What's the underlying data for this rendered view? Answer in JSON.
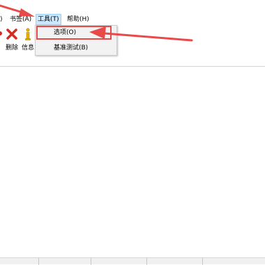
{
  "menubar": {
    "items": [
      {
        "label": ")"
      },
      {
        "label": "书签(A)"
      },
      {
        "label": "工具(T)"
      },
      {
        "label": "帮助(H)"
      }
    ]
  },
  "toolbar": {
    "delete_label": "删除",
    "info_label": "信息"
  },
  "tools_menu": {
    "items": [
      {
        "label": "选项(O)"
      },
      {
        "label": "基准测试(B)"
      }
    ]
  },
  "colors": {
    "annotation_red": "#e84a4a",
    "active_menu_bg": "#cce8ff",
    "delete_icon": "#d62b1f",
    "info_icon": "#e8b400"
  }
}
